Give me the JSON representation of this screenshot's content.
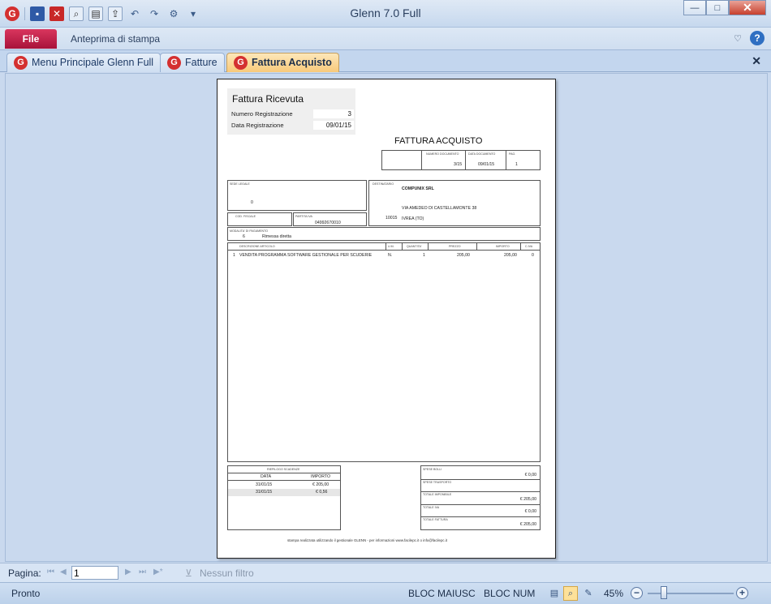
{
  "window": {
    "title": "Glenn 7.0 Full",
    "minimize": "—",
    "maximize": "□",
    "close": "✕"
  },
  "qat": {
    "logo": "G"
  },
  "ribbon": {
    "file_label": "File",
    "tab_label": "Anteprima di stampa"
  },
  "doctabs": [
    {
      "label": "Menu Principale Glenn Full"
    },
    {
      "label": "Fatture"
    },
    {
      "label": "Fattura Acquisto"
    }
  ],
  "doc_close": "✕",
  "invoice": {
    "ricevuta": {
      "title": "Fattura Ricevuta",
      "num_label": "Numero Registrazione",
      "num_value": "3",
      "date_label": "Data Registrazione",
      "date_value": "09/01/15"
    },
    "title": "FATTURA ACQUISTO",
    "doc_header": {
      "num_label": "NUMERO DOCUMENTO",
      "num_value": "3/15",
      "date_label": "DATA DOCUMENTO",
      "date_value": "09/01/15",
      "pag_label": "PAG.",
      "pag_value": "1"
    },
    "sede_label": "SEDE LEGALE",
    "sede_value": "0",
    "destinatario_label": "DESTINATARIO",
    "company": "COMPUNIX SRL",
    "address": "VIA AMEDEO DI CASTELLAMONTE 38",
    "cap": "10015",
    "city": "IVREA  (TO)",
    "cf_label": "COD. FISCALE",
    "piva_label": "PARTITA IVA",
    "piva_value": "04992670010",
    "pagamento_label": "MODALITA' DI PAGAMENTO",
    "pagamento_code": "6",
    "pagamento_value": "Rimessa diretta",
    "columns": [
      "DESCRIZIONE ARTICOLO",
      "U.M.",
      "QUANTITA'",
      "PREZZO",
      "IMPORTO",
      "C.IVA"
    ],
    "rows": [
      {
        "n": "1",
        "desc": "VENDITA PROGRAMMA SOFTWARE GESTIONALE PER SCUDERIE",
        "um": "N.",
        "qty": "1",
        "price": "205,00",
        "amount": "205,00",
        "iva": "0"
      }
    ],
    "scadenze": {
      "title": "RIEPILOGO SCADENZE",
      "col_data": "DATA",
      "col_importo": "IMPORTO",
      "items": [
        {
          "data": "31/01/15",
          "importo": "€ 205,00"
        },
        {
          "data": "31/01/15",
          "importo": "€ 0,56"
        }
      ]
    },
    "totals": {
      "spese_bolli_label": "SPESE BOLLI",
      "spese_bolli": "€ 0,00",
      "spese_trasporto_label": "SPESE TRASPORTO",
      "imponibile_label": "TOTALE IMPONIBILE",
      "imponibile": "€ 205,00",
      "iva_label": "TOTALE IVA",
      "iva": "€ 0,00",
      "fattura_label": "TOTALE FATTURA",
      "fattura": "€ 205,00"
    },
    "footer": "stampa realizzata utilizzando il gestionale GLENN - per informazioni  www.facilepc.it  o info@facilepc.it"
  },
  "navbar": {
    "label": "Pagina:",
    "page_value": "1",
    "filter": "Nessun filtro"
  },
  "status": {
    "text": "Pronto",
    "caps": "BLOC MAIUSC",
    "num": "BLOC NUM",
    "zoom": "45%"
  }
}
